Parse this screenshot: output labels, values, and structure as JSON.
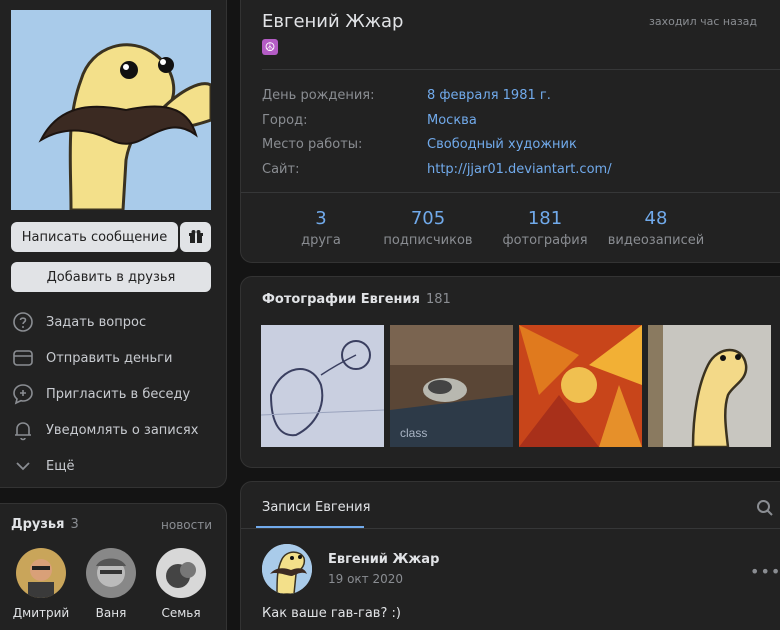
{
  "profile": {
    "name": "Евгений Жжар",
    "status_emoji": "☮",
    "last_seen": "заходил час назад",
    "info": [
      {
        "key": "День рождения:",
        "value": "8 февраля 1981 г."
      },
      {
        "key": "Город:",
        "value": "Москва"
      },
      {
        "key": "Место работы:",
        "value": "Свободный художник"
      },
      {
        "key": "Сайт:",
        "value": "http://jjar01.deviantart.com/"
      }
    ],
    "stats": [
      {
        "number": "3",
        "label": "друга"
      },
      {
        "number": "705",
        "label": "подписчиков"
      },
      {
        "number": "181",
        "label": "фотография"
      },
      {
        "number": "48",
        "label": "видеозаписей"
      }
    ]
  },
  "left": {
    "message_button": "Написать сообщение",
    "add_friend_button": "Добавить в друзья",
    "actions": [
      {
        "label": "Задать вопрос",
        "icon": "question-icon"
      },
      {
        "label": "Отправить деньги",
        "icon": "wallet-icon"
      },
      {
        "label": "Пригласить в беседу",
        "icon": "chat-add-icon"
      },
      {
        "label": "Уведомлять о записях",
        "icon": "bell-icon"
      },
      {
        "label": "Ещё",
        "icon": "chevron-down-icon"
      }
    ]
  },
  "friends": {
    "title": "Друзья",
    "count": "3",
    "news_link": "новости",
    "items": [
      {
        "name": "Дмитрий"
      },
      {
        "name": "Ваня"
      },
      {
        "name": "Семья"
      }
    ]
  },
  "photos": {
    "title": "Фотографии Евгения",
    "count": "181"
  },
  "posts": {
    "tab": "Записи Евгения",
    "post": {
      "author": "Евгений Жжар",
      "date": "19 окт 2020",
      "text": "Как ваше гав-гав? :)",
      "more": "•••"
    }
  },
  "colors": {
    "background": "#141414",
    "card": "#222222",
    "link": "#71aaeb",
    "muted": "#8a8d92",
    "text": "#e1e3e6"
  }
}
